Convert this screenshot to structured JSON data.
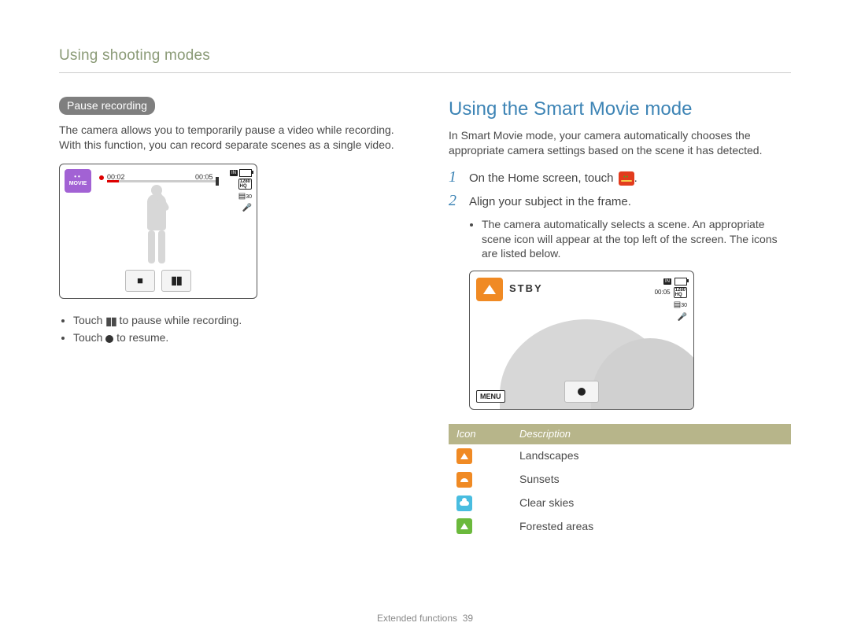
{
  "header": "Using shooting modes",
  "left": {
    "pill": "Pause recording",
    "para": "The camera allows you to temporarily pause a video while recording. With this function, you can record separate scenes as a single video.",
    "screen": {
      "mode_label": "MOVIE",
      "time_start": "00:02",
      "time_end": "00:05",
      "res_top": "1280",
      "res_bottom": "HQ",
      "fps": "30"
    },
    "bullet1_pre": "Touch ",
    "bullet1_post": " to pause while recording.",
    "bullet2_pre": "Touch ",
    "bullet2_post": " to resume."
  },
  "right": {
    "title": "Using the Smart Movie mode",
    "intro": "In Smart Movie mode, your camera automatically chooses the appropriate camera settings based on the scene it has detected.",
    "step1": "On the Home screen, touch ",
    "step1_post": ".",
    "step2": "Align your subject in the frame.",
    "sub1": "The camera automatically selects a scene. An appropriate scene icon will appear at the top left of the screen. The icons are listed below.",
    "screen": {
      "stby": "STBY",
      "time": "00:05",
      "res_top": "1280",
      "res_bottom": "HQ",
      "fps": "30",
      "menu": "MENU"
    },
    "table": {
      "head_icon": "Icon",
      "head_desc": "Description",
      "rows": [
        {
          "label": "Landscapes"
        },
        {
          "label": "Sunsets"
        },
        {
          "label": "Clear skies"
        },
        {
          "label": "Forested areas"
        }
      ]
    }
  },
  "footer": {
    "chapter": "Extended functions",
    "page": "39"
  }
}
